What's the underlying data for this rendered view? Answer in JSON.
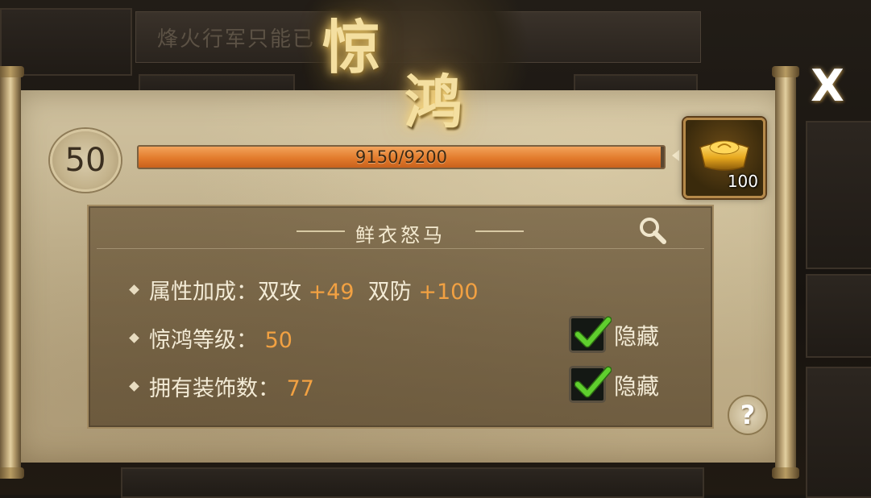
{
  "background": {
    "banner_text": "烽火行军只能已"
  },
  "panel": {
    "title_char_1": "惊",
    "title_char_2": "鸿",
    "close_label": "X",
    "level": "50",
    "exp": {
      "current": 9150,
      "max": 9200,
      "label": "9150/9200",
      "fill_fraction": 0.9946
    },
    "reward": {
      "icon": "gold-ingot-icon",
      "count": "100"
    },
    "info": {
      "subtitle": "鲜衣怒马",
      "attr_label": "属性加成：",
      "attr_atk_label": "双攻",
      "attr_atk_value": "+49",
      "attr_def_label": "双防",
      "attr_def_value": "+100",
      "level_label": "惊鸿等级：",
      "level_value": "50",
      "decor_label": "拥有装饰数：",
      "decor_value": "77",
      "hide_label_1": "隐藏",
      "hide_label_2": "隐藏",
      "hide_checked_1": true,
      "hide_checked_2": true
    },
    "help_label": "?"
  },
  "colors": {
    "value_orange": "#f2a142",
    "check_green": "#52c22a",
    "title_gold": "#f4dfa0"
  }
}
